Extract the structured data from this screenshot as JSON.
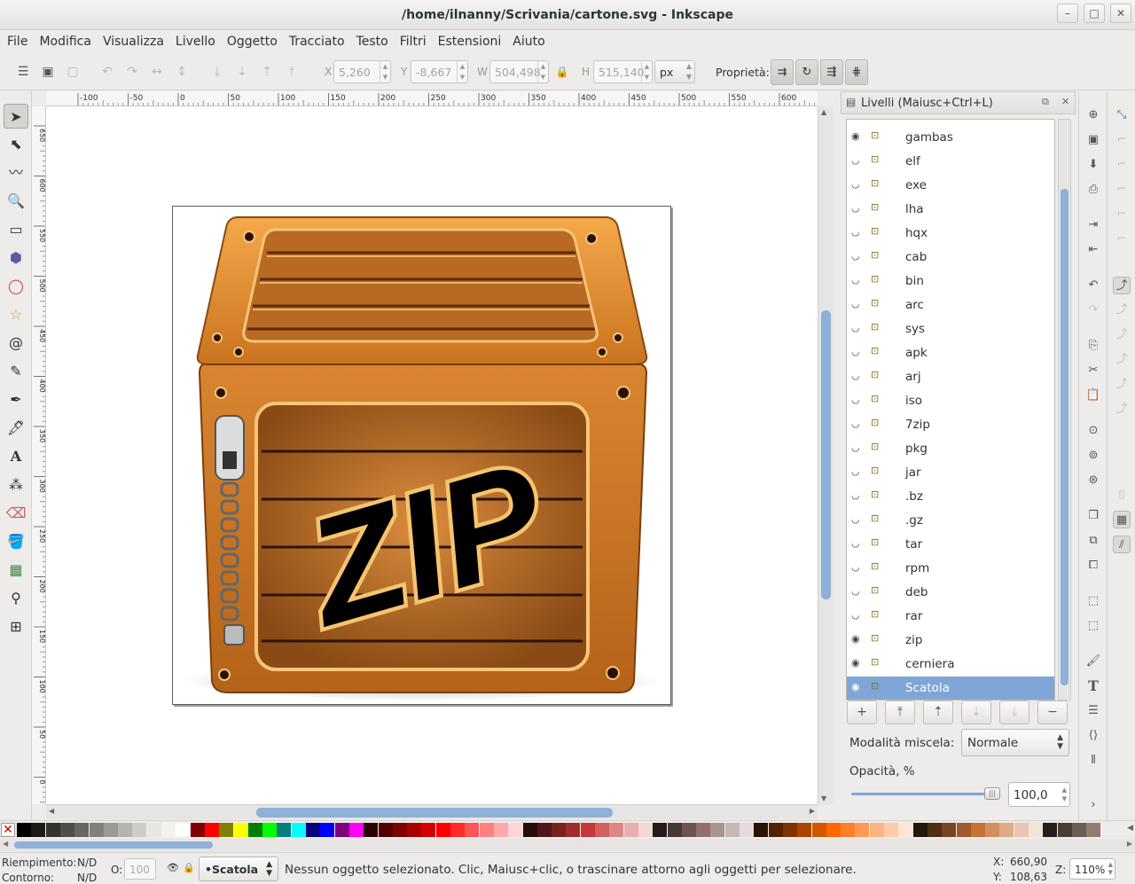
{
  "window": {
    "title": "/home/ilnanny/Scrivania/cartone.svg - Inkscape",
    "btn_min": "–",
    "btn_max": "□",
    "btn_close": "✕"
  },
  "menu": [
    "File",
    "Modifica",
    "Visualizza",
    "Livello",
    "Oggetto",
    "Tracciato",
    "Testo",
    "Filtri",
    "Estensioni",
    "Aiuto"
  ],
  "controls": {
    "x_label": "X",
    "x_value": "5,260",
    "y_label": "Y",
    "y_value": "-8,667",
    "w_label": "W",
    "w_value": "504,498",
    "h_label": "H",
    "h_value": "515,140",
    "unit": "px",
    "props_label": "Proprietà:"
  },
  "hruler_labels": [
    "-100",
    "-50",
    "0",
    "50",
    "100",
    "150",
    "200",
    "250",
    "300",
    "350",
    "400",
    "450",
    "500",
    "550",
    "600",
    "65"
  ],
  "vruler_labels": [
    "650",
    "600",
    "550",
    "500",
    "450",
    "400",
    "350",
    "300",
    "250",
    "200",
    "150",
    "100",
    "50",
    "0"
  ],
  "artwork": {
    "zip_text": "ZIP"
  },
  "layers_panel": {
    "title": "Livelli (Maiusc+Ctrl+L)",
    "layers": [
      {
        "name": "gambas",
        "visible": true
      },
      {
        "name": "elf",
        "visible": false
      },
      {
        "name": "exe",
        "visible": false
      },
      {
        "name": "lha",
        "visible": false
      },
      {
        "name": "hqx",
        "visible": false
      },
      {
        "name": "cab",
        "visible": false
      },
      {
        "name": "bin",
        "visible": false
      },
      {
        "name": "arc",
        "visible": false
      },
      {
        "name": "sys",
        "visible": false
      },
      {
        "name": "apk",
        "visible": false
      },
      {
        "name": "arj",
        "visible": false
      },
      {
        "name": "iso",
        "visible": false
      },
      {
        "name": "7zip",
        "visible": false
      },
      {
        "name": "pkg",
        "visible": false
      },
      {
        "name": "jar",
        "visible": false
      },
      {
        "name": ".bz",
        "visible": false
      },
      {
        "name": ".gz",
        "visible": false
      },
      {
        "name": "tar",
        "visible": false
      },
      {
        "name": "rpm",
        "visible": false
      },
      {
        "name": "deb",
        "visible": false
      },
      {
        "name": "rar",
        "visible": false
      },
      {
        "name": "zip",
        "visible": true
      },
      {
        "name": "cerniera",
        "visible": true
      },
      {
        "name": "Scatola",
        "visible": true,
        "selected": true
      }
    ],
    "blend_label": "Modalità miscela:",
    "blend_value": "Normale",
    "opacity_label": "Opacità, %",
    "opacity_value": "100,0",
    "opacity_fraction": 1.0
  },
  "palette": [
    "#000000",
    "#1a1a1a",
    "#333333",
    "#4d4d4d",
    "#666666",
    "#808080",
    "#999999",
    "#b3b3b3",
    "#cccccc",
    "#e6e6e6",
    "#f2f2f2",
    "#ffffff",
    "#800000",
    "#ff0000",
    "#808000",
    "#ffff00",
    "#008000",
    "#00ff00",
    "#008080",
    "#00ffff",
    "#000080",
    "#0000ff",
    "#800080",
    "#ff00ff",
    "#2b0000",
    "#550000",
    "#800000",
    "#aa0000",
    "#d40000",
    "#ff0000",
    "#ff2a2a",
    "#ff5555",
    "#ff8080",
    "#ffaaaa",
    "#ffd5d5",
    "#280b0b",
    "#501616",
    "#782121",
    "#a02c2c",
    "#c83737",
    "#d35f5f",
    "#de8787",
    "#e9afaf",
    "#f4d7d7",
    "#241c1c",
    "#483737",
    "#6c5353",
    "#916f6f",
    "#ac9393",
    "#c8b7b7",
    "#e3dbdb",
    "#2b1100",
    "#552200",
    "#803300",
    "#aa4400",
    "#d45500",
    "#ff6600",
    "#ff7f2a",
    "#ff9955",
    "#ffb380",
    "#ffccaa",
    "#ffe6d5",
    "#28170b",
    "#502d16",
    "#784421",
    "#a05a2c",
    "#c87137",
    "#d38d5f",
    "#deaa87",
    "#e9c6af",
    "#f4e3d7",
    "#241f1c",
    "#483e37",
    "#6c5d53",
    "#917c6f"
  ],
  "status": {
    "fill_label": "Riempimento:",
    "fill_value": "N/D",
    "stroke_label": "Contorno:",
    "stroke_value": "N/D",
    "opacity_label": "O:",
    "opacity_value": "100",
    "layer": "•Scatola",
    "message": "Nessun oggetto selezionato. Clic, Maiusc+clic, o trascinare attorno agli oggetti per selezionare.",
    "x_label": "X:",
    "x_value": "660,90",
    "y_label": "Y:",
    "y_value": "108,63",
    "zoom_label": "Z:",
    "zoom_value": "110%"
  }
}
